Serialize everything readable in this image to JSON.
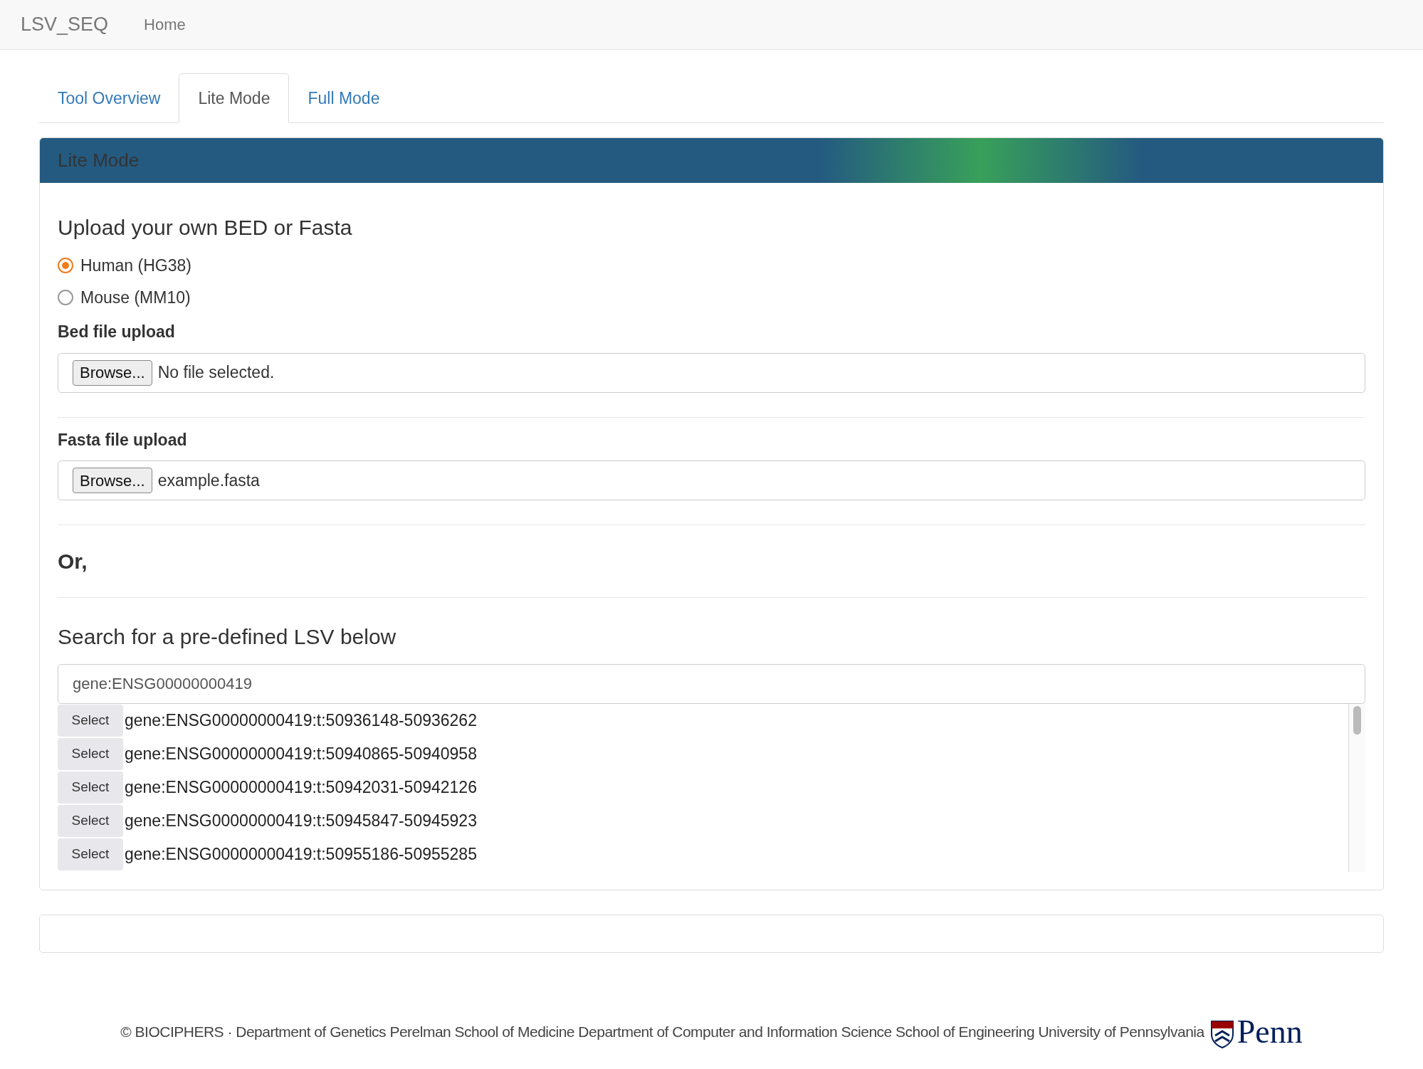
{
  "navbar": {
    "brand": "LSV_SEQ",
    "links": [
      "Home"
    ]
  },
  "tabs": [
    {
      "label": "Tool Overview",
      "selected": false
    },
    {
      "label": "Lite Mode",
      "selected": true
    },
    {
      "label": "Full Mode",
      "selected": false
    }
  ],
  "panel": {
    "title": "Lite Mode",
    "upload_heading": "Upload your own BED or Fasta",
    "species": [
      {
        "label": "Human (HG38)",
        "selected": true
      },
      {
        "label": "Mouse (MM10)",
        "selected": false
      }
    ],
    "uploads": [
      {
        "label": "Bed file upload",
        "button": "Browse...",
        "value": "No file selected."
      },
      {
        "label": "Fasta file upload",
        "button": "Browse...",
        "value": "example.fasta"
      }
    ],
    "or_text": "Or,",
    "search_heading": "Search for a pre-defined LSV below",
    "search_value": "gene:ENSG00000000419",
    "results": [
      {
        "button": "Select",
        "text": "gene:ENSG00000000419:t:50936148-50936262"
      },
      {
        "button": "Select",
        "text": "gene:ENSG00000000419:t:50940865-50940958"
      },
      {
        "button": "Select",
        "text": "gene:ENSG00000000419:t:50942031-50942126"
      },
      {
        "button": "Select",
        "text": "gene:ENSG00000000419:t:50945847-50945923"
      },
      {
        "button": "Select",
        "text": "gene:ENSG00000000419:t:50955186-50955285"
      }
    ]
  },
  "footer": {
    "text": "© BIOCIPHERS · Department of Genetics Perelman School of Medicine Department of Computer and Information Science School of Engineering University of Pennsylvania",
    "logo_text": "Penn"
  }
}
